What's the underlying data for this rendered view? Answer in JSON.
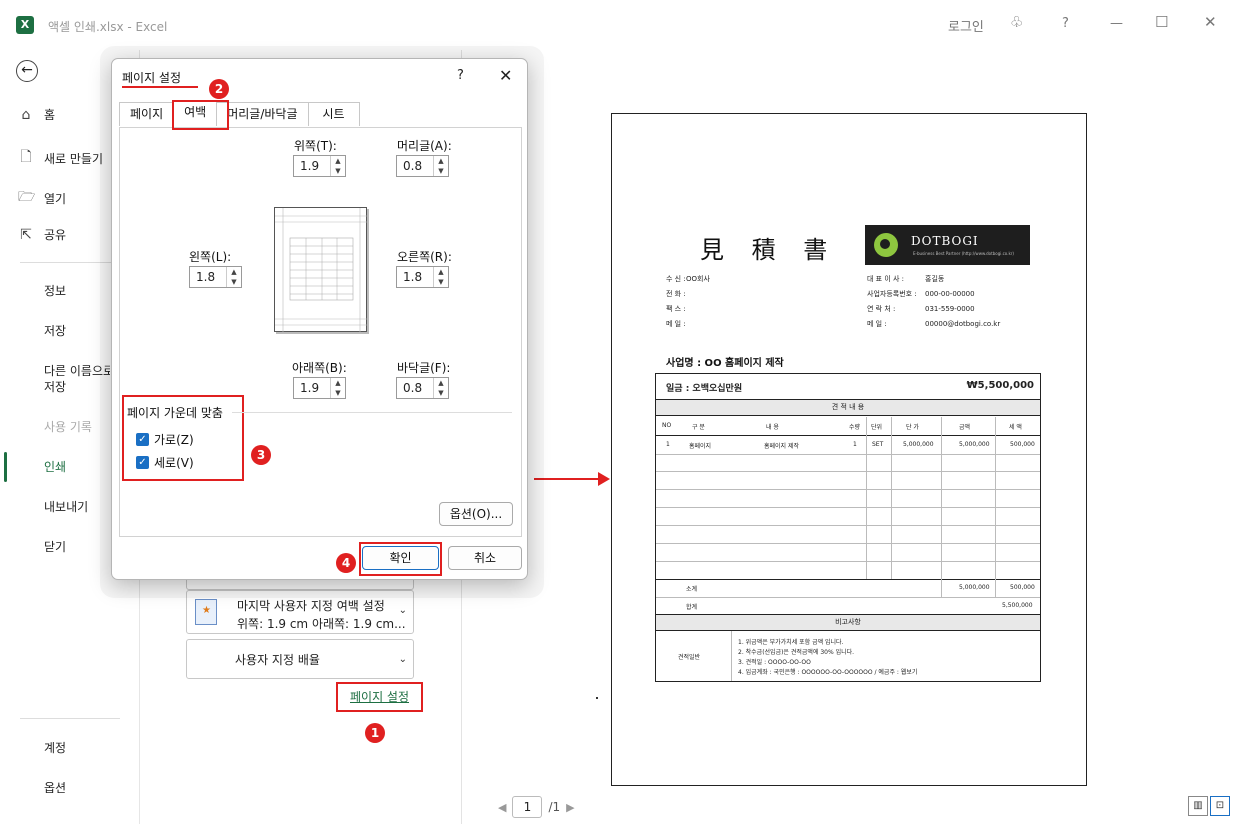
{
  "window": {
    "app_icon": "X",
    "title": "액셀 인쇄.xlsx  -  Excel",
    "login": "로그인",
    "help": "?"
  },
  "nav": {
    "items": [
      {
        "label": "홈",
        "icon": "home-icon"
      },
      {
        "label": "새로 만들기",
        "icon": "new-file-icon"
      },
      {
        "label": "열기",
        "icon": "folder-icon"
      },
      {
        "label": "공유",
        "icon": "share-icon"
      }
    ],
    "sub_items": [
      "정보",
      "저장",
      "다른 이름으로",
      "저장",
      "사용 기록",
      "인쇄",
      "내보내기",
      "닫기"
    ],
    "bottom": [
      "계정",
      "옵션"
    ]
  },
  "settings": {
    "margin_combo_line1": "마지막 사용자 지정 여백 설정",
    "margin_combo_line2": "위쪽: 1.9 cm 아래쪽: 1.9 cm...",
    "scaling_combo": "사용자 지정 배율",
    "page_setup_link": "페이지 설정"
  },
  "dialog": {
    "title": "페이지 설정",
    "help": "?",
    "close": "✕",
    "tabs": [
      "페이지",
      "여백",
      "머리글/바닥글",
      "시트"
    ],
    "top_label": "위쪽(T):",
    "top_value": "1.9",
    "header_label": "머리글(A):",
    "header_value": "0.8",
    "left_label": "왼쪽(L):",
    "left_value": "1.8",
    "right_label": "오른쪽(R):",
    "right_value": "1.8",
    "bottom_label": "아래쪽(B):",
    "bottom_value": "1.9",
    "footer_label": "바닥글(F):",
    "footer_value": "0.8",
    "center_title": "페이지 가운데 맞춤",
    "horizontal": "가로(Z)",
    "vertical": "세로(V)",
    "options_btn": "옵션(O)...",
    "ok_btn": "확인",
    "cancel_btn": "취소"
  },
  "steps": [
    "1",
    "2",
    "3",
    "4"
  ],
  "pager": {
    "current": "1",
    "total": "/1"
  },
  "quote": {
    "title": "見 積 書",
    "logo_text": "DOTBOGI",
    "logo_sub": "E-business Best Partner (http://www.dotbogi.co.kr)",
    "left_info": [
      {
        "k": "수 신 :",
        "v": "OO회사"
      },
      {
        "k": "전 화 :",
        "v": ""
      },
      {
        "k": "팩 스 :",
        "v": ""
      },
      {
        "k": "메 일 :",
        "v": ""
      }
    ],
    "right_info": [
      {
        "k": "대 표 이 사 :",
        "v": "홍길동"
      },
      {
        "k": "사업자등록번호 :",
        "v": "000-00-00000"
      },
      {
        "k": "연    락    처 :",
        "v": "031-559-0000"
      },
      {
        "k": "메          일 :",
        "v": "00000@dotbogi.co.kr"
      }
    ],
    "project": "사업명 : OO 홈페이지 제작",
    "total_label": "일금 : 오백오십만원",
    "total_value": "₩5,500,000",
    "band1": "견 적 내 용",
    "headers": [
      "NO",
      "구   분",
      "내        용",
      "수량",
      "단위",
      "단 가",
      "금액",
      "세 액"
    ],
    "row1": [
      "1",
      "홈페이지",
      "홈페이지 제작",
      "1",
      "SET",
      "5,000,000",
      "5,000,000",
      "500,000"
    ],
    "subtotal_label": "소계",
    "subtotal_amount": "5,000,000",
    "subtotal_tax": "500,000",
    "grand_label": "합계",
    "grand_value": "5,500,000",
    "band2": "비고사항",
    "remark_label": "견적일반",
    "remarks": [
      "1. 위금액은 부가가치세 포함 금액 입니다.",
      "2. 착수금(선입금)은 견적금액에 30% 입니다.",
      "3. 견적일 : OOOO-OO-OO",
      "4. 입금계좌 : 국민은행 : OOOOOO-OO-OOOOOO  / 예금주 : 웹보기"
    ]
  }
}
